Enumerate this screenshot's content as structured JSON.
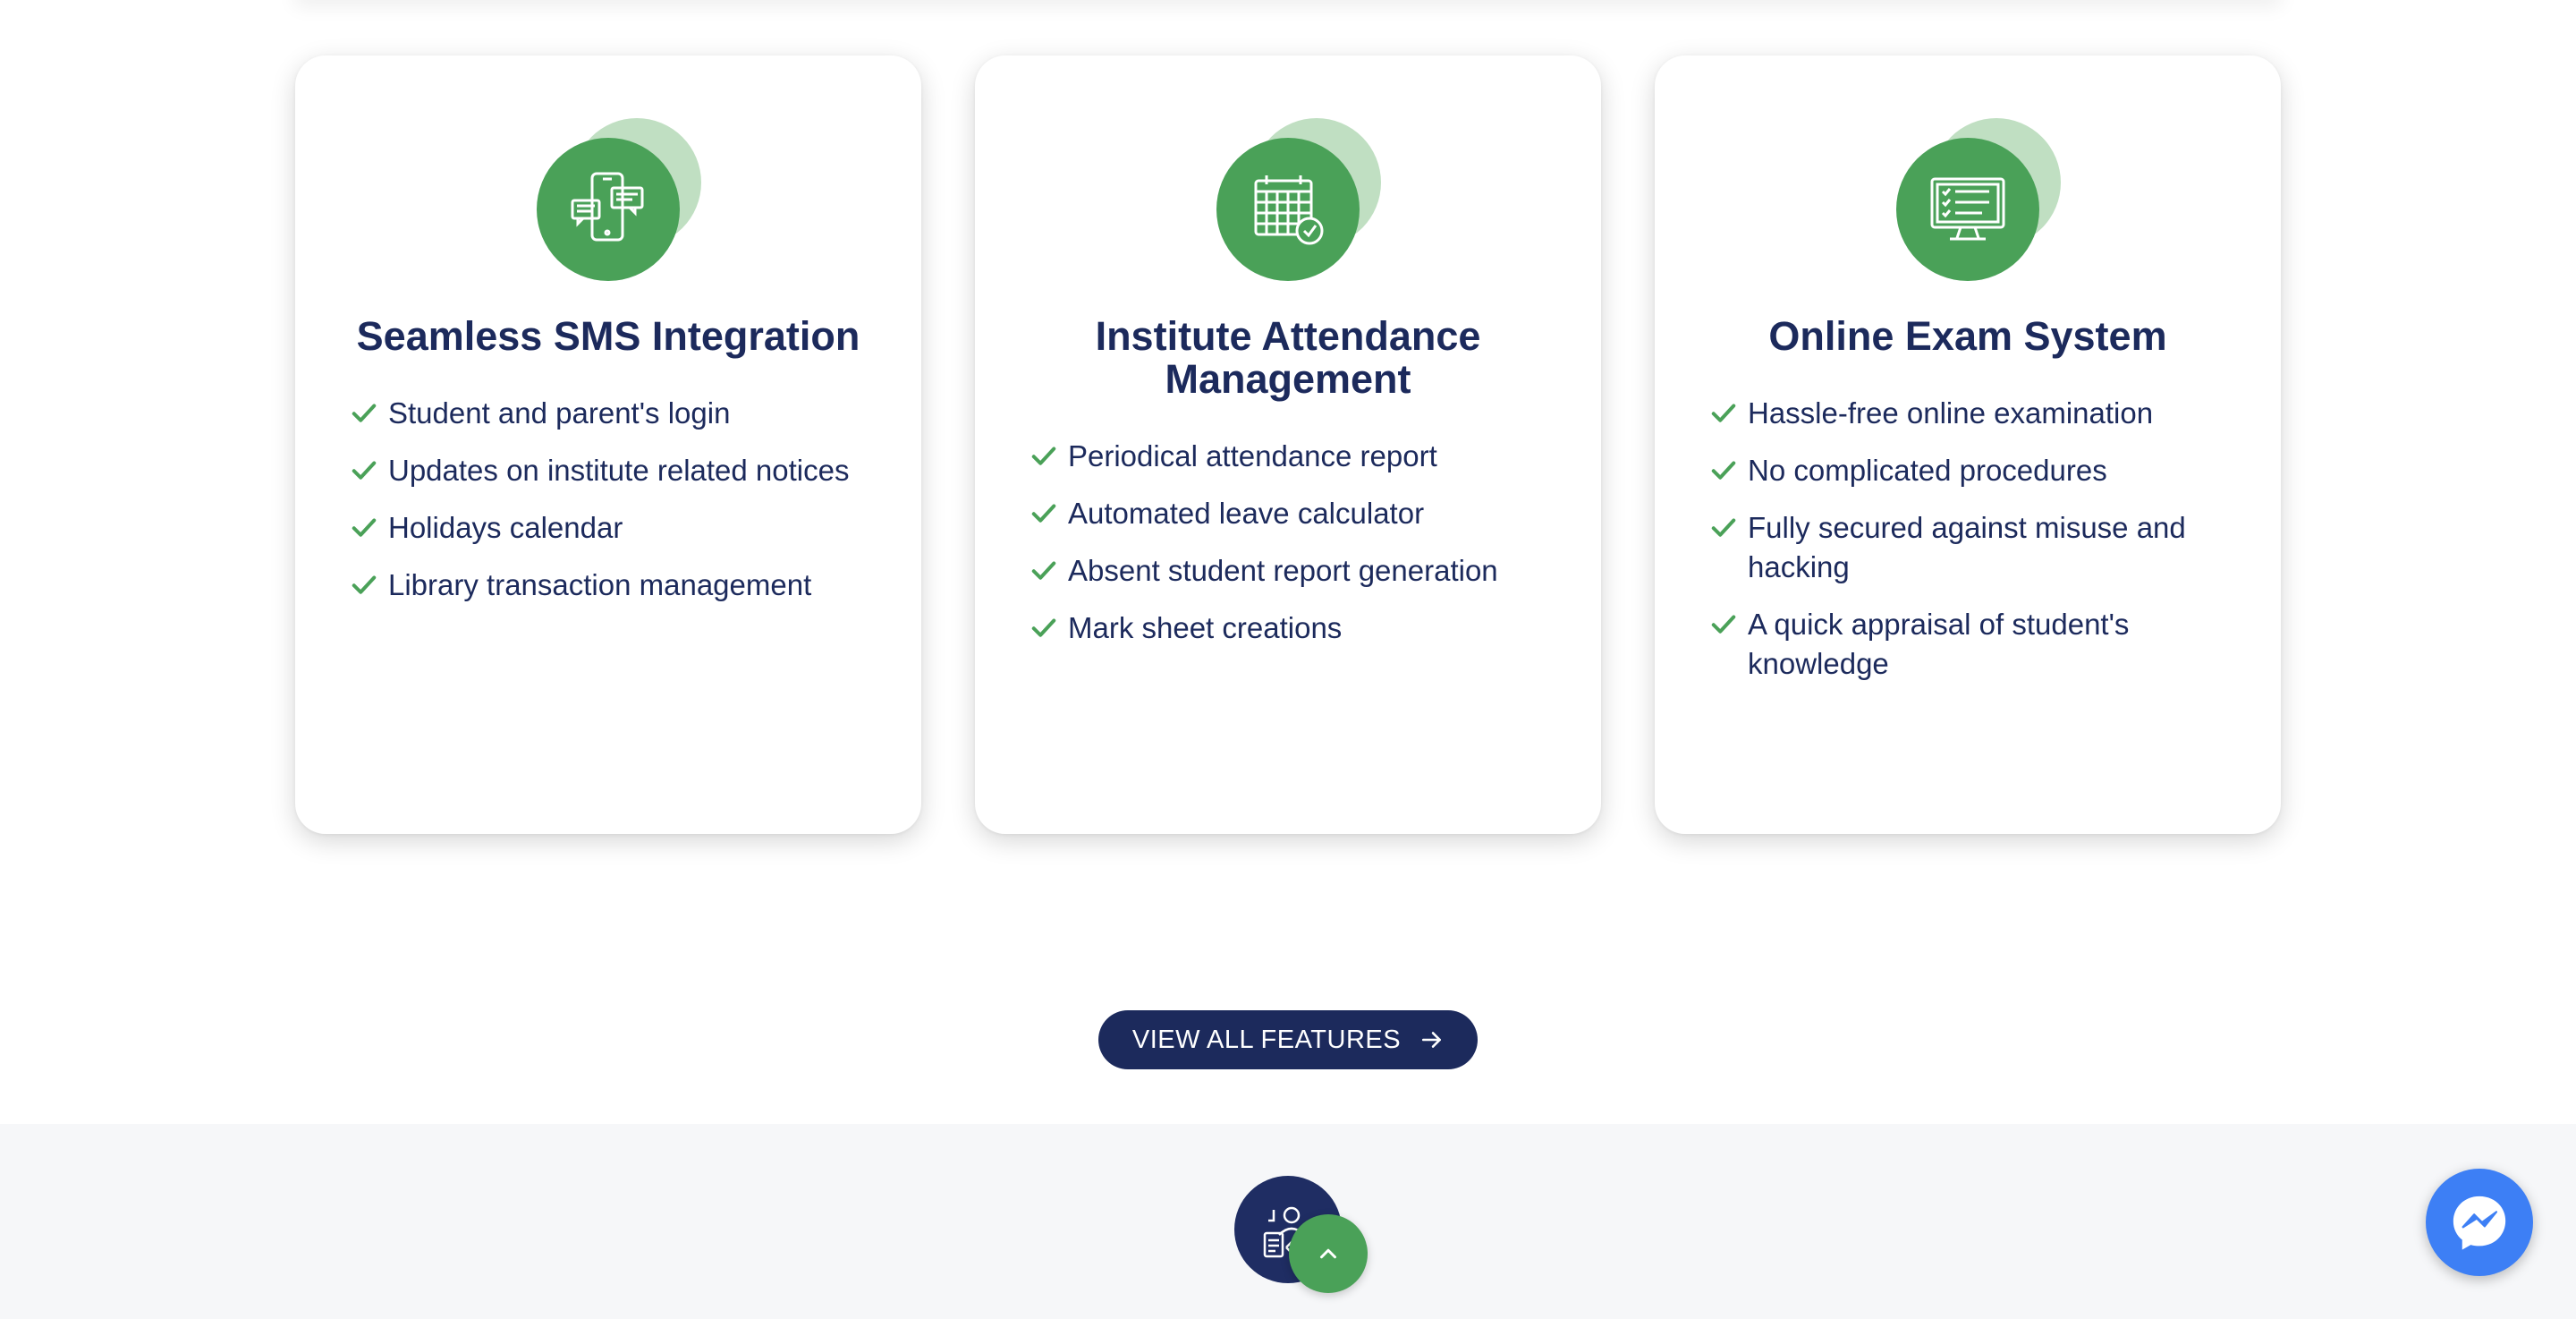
{
  "features": [
    {
      "title": "Seamless SMS Integration",
      "icon": "phone-chat-icon",
      "items": [
        "Student and parent's login",
        "Updates on institute related notices",
        "Holidays calendar",
        "Library transaction management"
      ]
    },
    {
      "title": "Institute Attendance Management",
      "icon": "calendar-clock-icon",
      "items": [
        "Periodical attendance report",
        "Automated leave calculator",
        "Absent student report generation",
        "Mark sheet creations"
      ]
    },
    {
      "title": "Online Exam System",
      "icon": "monitor-checklist-icon",
      "items": [
        "Hassle-free online examination",
        "No complicated procedures",
        "Fully secured against misuse and hacking",
        "A quick appraisal of student's knowledge"
      ]
    }
  ],
  "cta": {
    "label": "VIEW ALL FEATURES",
    "icon": "arrow-right-icon"
  },
  "colors": {
    "navy": "#1c2a5c",
    "green": "#4aa158",
    "light_green": "#c0dfc2",
    "messenger_blue": "#3d7ff5"
  }
}
